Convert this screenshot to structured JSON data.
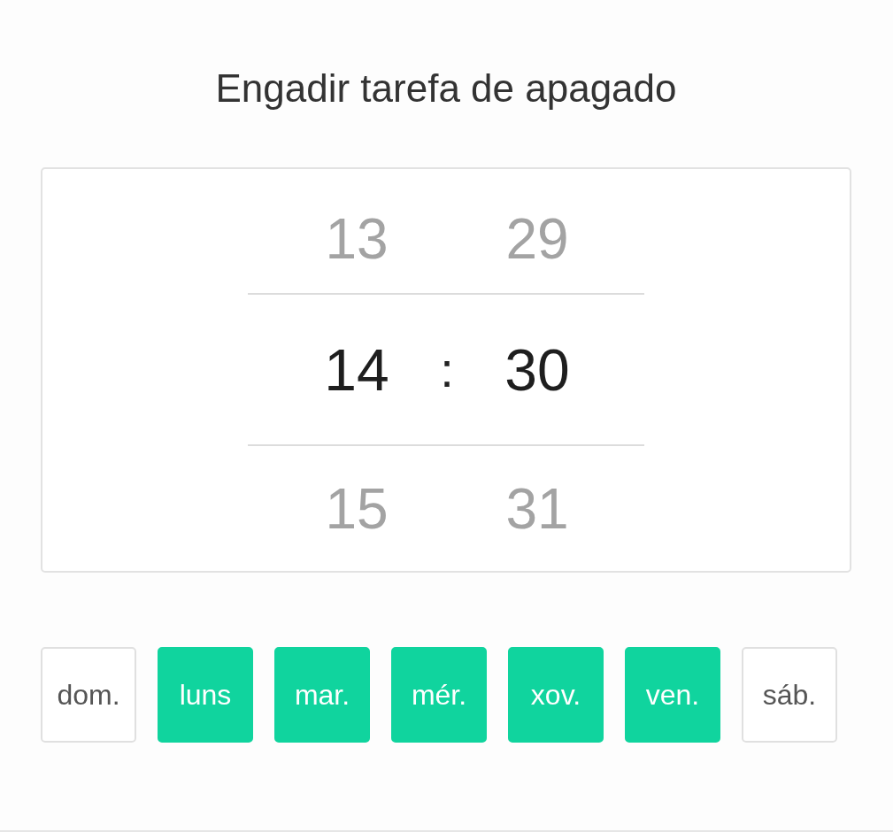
{
  "title": "Engadir tarefa de apagado",
  "picker": {
    "separator": ":",
    "columns": [
      {
        "kind": "hour",
        "items": [
          {
            "value": "13",
            "selected": false
          },
          {
            "value": "14",
            "selected": true
          },
          {
            "value": "15",
            "selected": false
          }
        ]
      },
      {
        "kind": "minute",
        "items": [
          {
            "value": "29",
            "selected": false
          },
          {
            "value": "30",
            "selected": true
          },
          {
            "value": "31",
            "selected": false
          }
        ]
      }
    ]
  },
  "days": [
    {
      "label": "dom.",
      "selected": false
    },
    {
      "label": "luns",
      "selected": true
    },
    {
      "label": "mar.",
      "selected": true
    },
    {
      "label": "mér.",
      "selected": true
    },
    {
      "label": "xov.",
      "selected": true
    },
    {
      "label": "ven.",
      "selected": true
    },
    {
      "label": "sáb.",
      "selected": false
    }
  ]
}
